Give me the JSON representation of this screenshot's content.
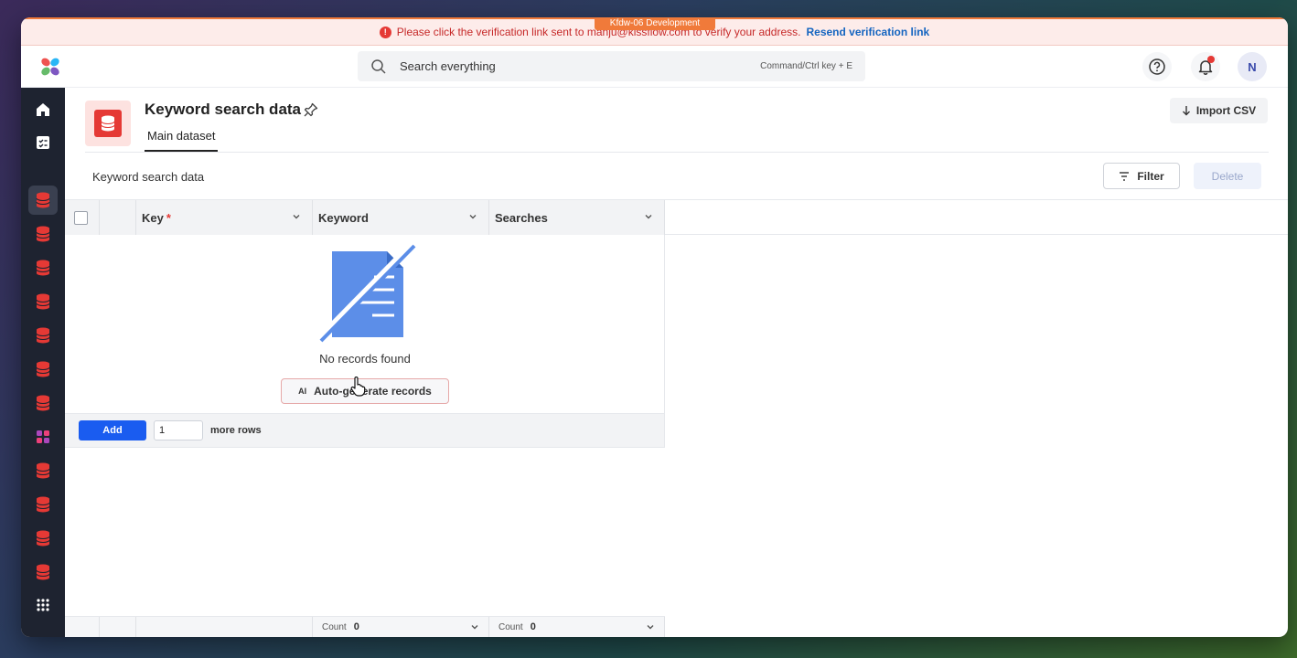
{
  "environment": "Kfdw-06 Development",
  "banner": {
    "message": "Please click the verification link sent to manju@kissflow.com to verify your address.",
    "link": "Resend verification link"
  },
  "search": {
    "placeholder": "Search everything",
    "shortcut": "Command/Ctrl key + E"
  },
  "user": {
    "initial": "N"
  },
  "dataset": {
    "title": "Keyword search data",
    "tab": "Main dataset",
    "section_label": "Keyword search data",
    "import_label": "Import CSV"
  },
  "toolbar": {
    "filter_label": "Filter",
    "delete_label": "Delete"
  },
  "columns": [
    {
      "label": "Key",
      "required": "*"
    },
    {
      "label": "Keyword"
    },
    {
      "label": "Searches"
    }
  ],
  "empty_state": {
    "text": "No records found",
    "auto_generate_label": "Auto-generate records",
    "ai_badge": "AI"
  },
  "add_rows": {
    "button": "Add",
    "value": "1",
    "suffix": "more rows"
  },
  "footer": {
    "count_label": "Count",
    "keyword_count": "0",
    "searches_count": "0"
  },
  "colors": {
    "accent": "#1a5cf0",
    "danger": "#e53935",
    "sidebar": "#1e2330",
    "env_badge": "#f07a3a"
  }
}
